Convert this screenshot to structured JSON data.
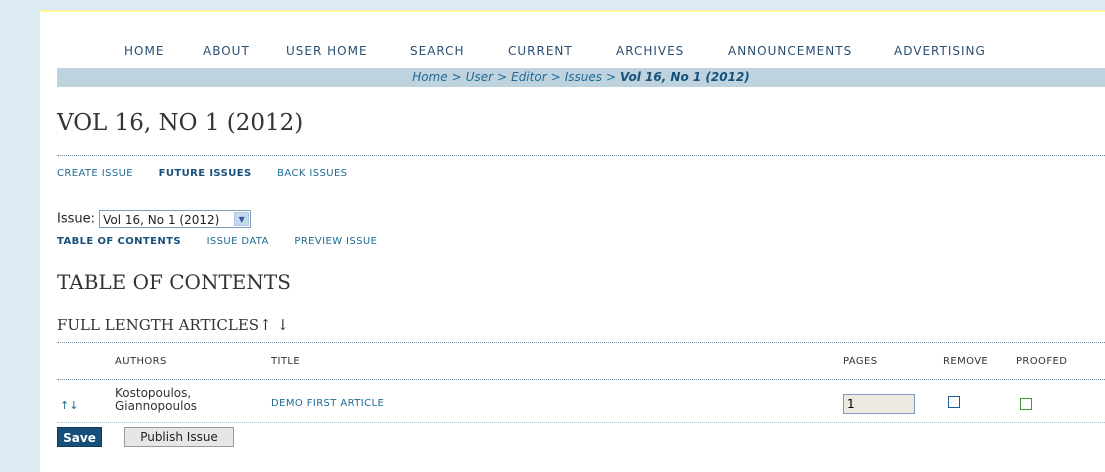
{
  "nav": {
    "items": [
      "HOME",
      "ABOUT",
      "USER HOME",
      "SEARCH",
      "CURRENT",
      "ARCHIVES",
      "ANNOUNCEMENTS",
      "ADVERTISING"
    ]
  },
  "breadcrumb": {
    "home": "Home",
    "user": "User",
    "editor": "Editor",
    "issues": "Issues",
    "current": "Vol 16, No 1 (2012)",
    "separator": ">"
  },
  "page_title": "VOL 16, NO 1 (2012)",
  "issue_links": {
    "create": "CREATE ISSUE",
    "future": "FUTURE ISSUES",
    "back": "BACK ISSUES"
  },
  "issue_select": {
    "label": "Issue:",
    "value": "Vol 16, No 1 (2012)"
  },
  "issue_tabs": {
    "toc": "TABLE OF CONTENTS",
    "data": "ISSUE DATA",
    "preview": "PREVIEW ISSUE"
  },
  "toc_title": "TABLE OF CONTENTS",
  "section": {
    "title": "FULL LENGTH ARTICLES",
    "up_arrow": "↑",
    "down_arrow": "↓"
  },
  "table": {
    "headers": {
      "authors": "AUTHORS",
      "title": "TITLE",
      "pages": "PAGES",
      "remove": "REMOVE",
      "proofed": "PROOFED"
    },
    "rows": [
      {
        "move": "↑↓",
        "authors_line1": "Kostopoulos,",
        "authors_line2": "Giannopoulos",
        "title": "DEMO FIRST ARTICLE",
        "pages": "1"
      }
    ]
  },
  "buttons": {
    "save": "Save",
    "publish": "Publish Issue"
  },
  "colors": {
    "accent": "#1f6a94",
    "nav_text": "#2a4f73",
    "breadcrumb_bg": "#bfd3de",
    "page_bg": "#dcebf3",
    "save_button": "#174f7b"
  }
}
